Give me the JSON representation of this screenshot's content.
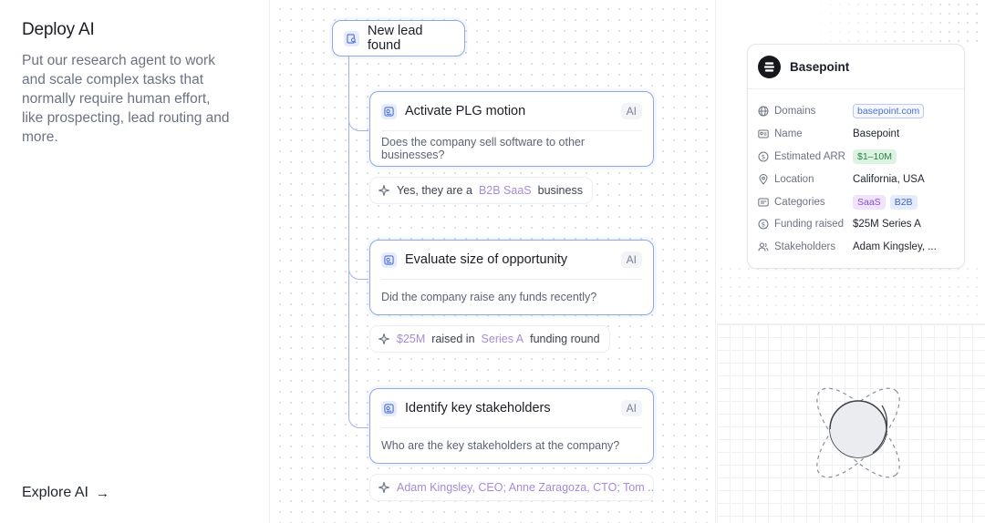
{
  "left": {
    "title": "Deploy AI",
    "description": "Put our research agent to work and scale complex tasks that normally require human effort, like prospecting, lead routing and more.",
    "cta_label": "Explore AI",
    "cta_icon": "arrow-right-icon"
  },
  "flow": {
    "root_label": "New lead found",
    "steps": [
      {
        "title": "Activate PLG motion",
        "badge": "AI",
        "question": "Does the company sell software to other businesses?",
        "answer_pre": "Yes, they are a ",
        "answer_hl": "B2B SaaS",
        "answer_post": " business"
      },
      {
        "title": "Evaluate size of opportunity",
        "badge": "AI",
        "question": "Did the company raise any funds recently?",
        "answer_hl1": "$25M",
        "answer_mid": " raised in ",
        "answer_hl2": "Series A",
        "answer_post": " funding round"
      },
      {
        "title": "Identify key stakeholders",
        "badge": "AI",
        "question": "Who are the key stakeholders at the company?",
        "answer_hl": "Adam Kingsley, CEO; Anne Zaragoza, CTO; Tom ..."
      }
    ]
  },
  "profile": {
    "company": "Basepoint",
    "rows": {
      "domains": {
        "label": "Domains",
        "value": "basepoint.com"
      },
      "name": {
        "label": "Name",
        "value": "Basepoint"
      },
      "arr": {
        "label": "Estimated ARR",
        "value": "$1–10M"
      },
      "location": {
        "label": "Location",
        "value": "California, USA"
      },
      "categories": {
        "label": "Categories",
        "values": [
          "SaaS",
          "B2B"
        ]
      },
      "funding": {
        "label": "Funding raised",
        "value": "$25M Series A"
      },
      "stakeholders": {
        "label": "Stakeholders",
        "value": "Adam Kingsley, ..."
      }
    }
  },
  "colors": {
    "accent_border": "#8fa7e2",
    "highlight_text": "#a98ad6",
    "connector": "#9fb4e6"
  }
}
